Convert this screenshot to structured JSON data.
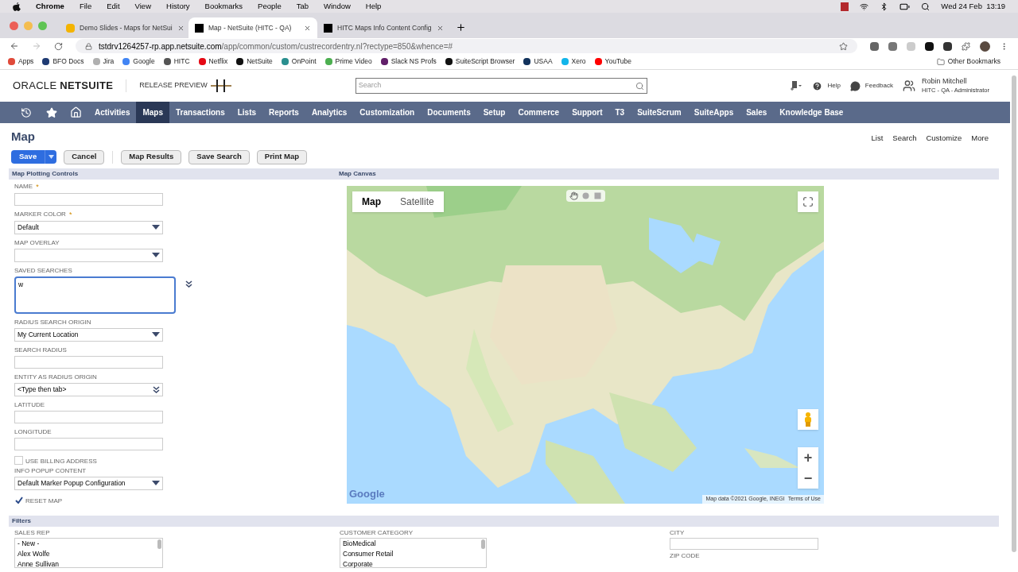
{
  "menubar": {
    "app": "Chrome",
    "items": [
      "File",
      "Edit",
      "View",
      "History",
      "Bookmarks",
      "People",
      "Tab",
      "Window",
      "Help"
    ],
    "clock": "Wed 24 Feb  13:19"
  },
  "browser": {
    "tabs": [
      {
        "title": "Demo Slides - Maps for NetSui",
        "selected": false
      },
      {
        "title": "Map - NetSuite (HITC - QA)",
        "selected": true
      },
      {
        "title": "HITC Maps Info Content Config",
        "selected": false
      }
    ],
    "url_host": "tstdrv1264257-rp.app.netsuite.com",
    "url_path": "/app/common/custom/custrecordentry.nl?rectype=850&whence=#",
    "bookmarks": [
      {
        "label": "Apps",
        "color": "#e04a3a"
      },
      {
        "label": "BFO Docs",
        "color": "#1f3b73"
      },
      {
        "label": "Jira",
        "color": "#b0b0b0"
      },
      {
        "label": "Google",
        "color": "#4285f4"
      },
      {
        "label": "HITC",
        "color": "#555555"
      },
      {
        "label": "Netflix",
        "color": "#e50914"
      },
      {
        "label": "NetSuite",
        "color": "#111111"
      },
      {
        "label": "OnPoint",
        "color": "#2a8f8f"
      },
      {
        "label": "Prime Video",
        "color": "#4caf50"
      },
      {
        "label": "Slack NS Profs",
        "color": "#611f69"
      },
      {
        "label": "SuiteScript Browser",
        "color": "#111111"
      },
      {
        "label": "USAA",
        "color": "#12325c"
      },
      {
        "label": "Xero",
        "color": "#13b5ea"
      },
      {
        "label": "YouTube",
        "color": "#ff0000"
      }
    ],
    "other_bookmarks": "Other Bookmarks"
  },
  "header": {
    "logo_brand": "ORACLE",
    "logo_product": "NETSUITE",
    "release": "RELEASE PREVIEW",
    "search": {
      "placeholder": "Search"
    },
    "help": "Help",
    "feedback": "Feedback",
    "user_name": "Robin Mitchell",
    "user_role": "HITC - QA - Administrator"
  },
  "nav": [
    {
      "label": "Activities",
      "selected": false
    },
    {
      "label": "Maps",
      "selected": true
    },
    {
      "label": "Transactions",
      "selected": false
    },
    {
      "label": "Lists",
      "selected": false
    },
    {
      "label": "Reports",
      "selected": false
    },
    {
      "label": "Analytics",
      "selected": false
    },
    {
      "label": "Customization",
      "selected": false
    },
    {
      "label": "Documents",
      "selected": false
    },
    {
      "label": "Setup",
      "selected": false
    },
    {
      "label": "Commerce",
      "selected": false
    },
    {
      "label": "Support",
      "selected": false
    },
    {
      "label": "T3",
      "selected": false
    },
    {
      "label": "SuiteScrum",
      "selected": false
    },
    {
      "label": "SuiteApps",
      "selected": false
    },
    {
      "label": "Sales",
      "selected": false
    },
    {
      "label": "Knowledge Base",
      "selected": false
    }
  ],
  "page": {
    "title": "Map",
    "links": [
      "List",
      "Search",
      "Customize",
      "More"
    ],
    "save": "Save",
    "buttons": [
      "Cancel",
      "Map Results",
      "Save Search",
      "Print Map"
    ]
  },
  "controls": {
    "title": "Map Plotting Controls",
    "fields": [
      {
        "kind": "text",
        "label": "NAME",
        "required_mark": "*"
      },
      {
        "kind": "select",
        "label": "MARKER COLOR",
        "required_mark": "*",
        "value": "Default"
      },
      {
        "kind": "select",
        "label": "MAP OVERLAY"
      },
      {
        "kind": "textarea",
        "label": "SAVED SEARCHES",
        "value": "w"
      },
      {
        "kind": "select",
        "label": "RADIUS SEARCH ORIGIN",
        "value": "My Current Location"
      },
      {
        "kind": "text",
        "label": "SEARCH RADIUS"
      },
      {
        "kind": "combo",
        "label": "ENTITY AS RADIUS ORIGIN",
        "value": "<Type then tab>"
      },
      {
        "kind": "text",
        "label": "LATITUDE"
      },
      {
        "kind": "text",
        "label": "LONGITUDE"
      },
      {
        "kind": "checkbox",
        "label": "USE BILLING ADDRESS",
        "checked": false
      },
      {
        "kind": "select",
        "label": "INFO POPUP CONTENT",
        "value": "Default Marker Popup Configuration"
      },
      {
        "kind": "checkbox",
        "label": "RESET MAP",
        "checked": true
      }
    ]
  },
  "map": {
    "title": "Map Canvas",
    "modes": [
      {
        "label": "Map",
        "selected": true
      },
      {
        "label": "Satellite",
        "selected": false
      }
    ],
    "logo": "Google",
    "attribution": "Map data ©2021 Google, INEGI",
    "terms": "Terms of Use",
    "zoom_in": "+",
    "zoom_out": "−"
  },
  "filters": {
    "title": "Filters",
    "sales_rep": {
      "label": "SALES REP",
      "items": [
        "- New -",
        "Alex Wolfe",
        "Anne Sullivan"
      ]
    },
    "customer_category": {
      "label": "CUSTOMER CATEGORY",
      "items": [
        "BioMedical",
        "Consumer Retail",
        "Corporate"
      ]
    },
    "city": {
      "label": "CITY"
    },
    "zip": {
      "label": "ZIP CODE"
    }
  }
}
